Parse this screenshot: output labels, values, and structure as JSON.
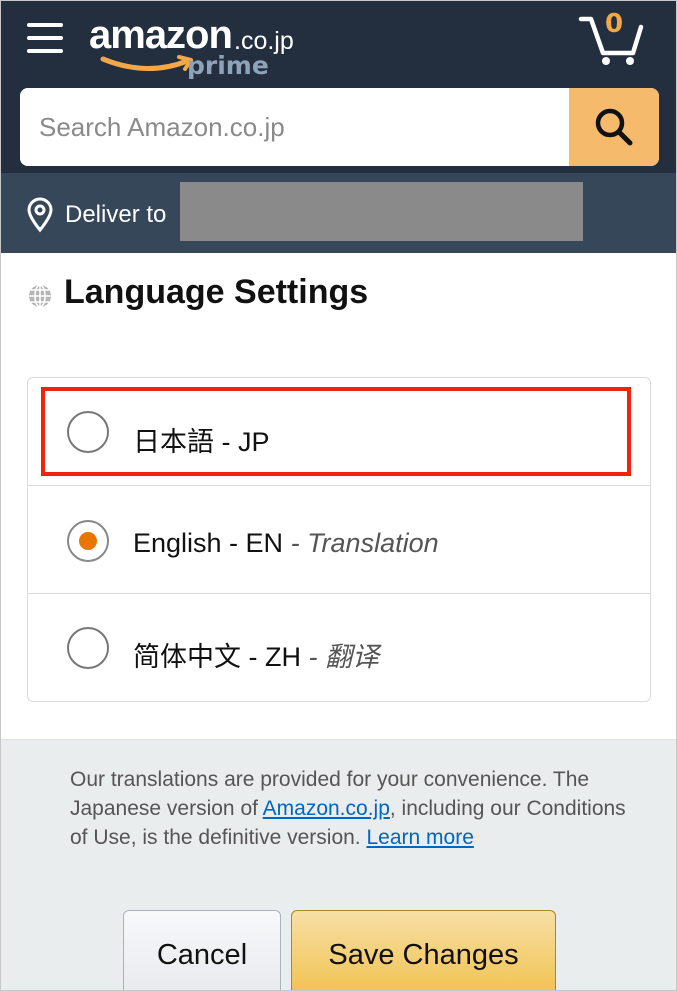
{
  "header": {
    "menu_icon": "hamburger-menu-icon",
    "logo": {
      "brand": "amazon",
      "domain": ".co.jp",
      "tier": "prime"
    },
    "cart": {
      "count": "0",
      "icon": "cart-icon"
    }
  },
  "search": {
    "placeholder": "Search Amazon.co.jp",
    "value": "",
    "icon": "search-icon"
  },
  "deliver": {
    "label": "Deliver to",
    "icon": "location-pin-icon"
  },
  "page": {
    "title": "Language Settings",
    "icon": "globe-icon"
  },
  "languages": [
    {
      "label": "日本語 - JP",
      "translation_note": "",
      "selected": false
    },
    {
      "label": "English - EN",
      "translation_note": "Translation",
      "selected": true
    },
    {
      "label": "简体中文 - ZH",
      "translation_note": "翻译",
      "selected": false
    }
  ],
  "disclaimer": {
    "text_before": "Our translations are provided for your convenience. The Japanese version of ",
    "link_site": "Amazon.co.jp",
    "text_middle": ", including our Conditions of Use, is the definitive version. ",
    "link_learn": "Learn more"
  },
  "buttons": {
    "cancel": "Cancel",
    "save": "Save Changes"
  },
  "colors": {
    "header_bg": "#232f3e",
    "deliver_bg": "#37475a",
    "search_button": "#f5ba6b",
    "accent_orange": "#e77600",
    "highlight_red": "#f0220b",
    "link": "#0066c0",
    "save_button": "#f0c14b"
  }
}
